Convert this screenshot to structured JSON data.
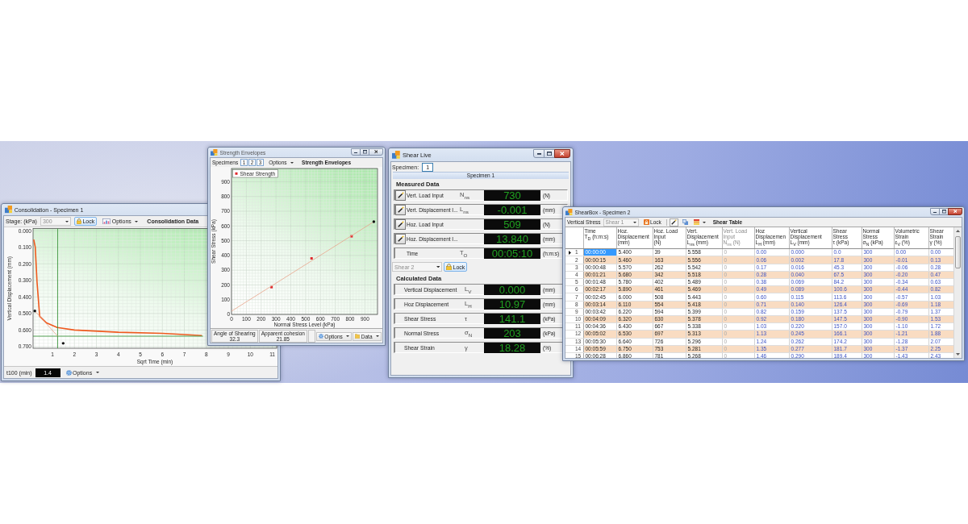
{
  "consolidation_window": {
    "title": "Consolidation - Specimen 1",
    "toolbar": {
      "stage_label": "Stage: (kPa)",
      "stage_dropdown": {
        "value": "300",
        "disabled": true
      },
      "lock_button": "Lock",
      "options_button": "Options",
      "heading": "Consolidation Data"
    },
    "chart_data": {
      "type": "line",
      "xlabel": "Sqrt Time (min)",
      "ylabel": "Vertical Displacement (mm)",
      "x": [
        0.15,
        0.22,
        0.3,
        0.42,
        0.73,
        1.22,
        2.0,
        4.0,
        6.0,
        7.8
      ],
      "values": [
        0.053,
        0.1,
        0.31,
        0.517,
        0.557,
        0.585,
        0.6,
        0.613,
        0.62,
        0.633
      ],
      "xlim": [
        0.12,
        11.2
      ],
      "ylim": [
        0.71,
        -0.013
      ],
      "xticks": [
        1,
        2,
        3,
        4,
        5,
        6,
        7,
        8,
        9,
        10,
        11
      ],
      "yticks": [
        {
          "value": 0,
          "label": "0.000"
        },
        {
          "value": 0.1,
          "label": "0.100"
        },
        {
          "value": 0.2,
          "label": "0.200"
        },
        {
          "value": 0.3,
          "label": "0.300"
        },
        {
          "value": 0.4,
          "label": "0.400"
        },
        {
          "value": 0.5,
          "label": "0.500"
        },
        {
          "value": 0.6,
          "label": "0.600"
        },
        {
          "value": 0.7,
          "label": "0.700"
        }
      ],
      "grid": true
    },
    "footer": {
      "t100_label": "t100 (min)",
      "t100_value": "1.4",
      "options_button": "Options"
    }
  },
  "strength_window": {
    "title": "Strength Envelopes",
    "active": false,
    "toolbar": {
      "specimens_label": "Specimens",
      "specimen_buttons": [
        "1",
        "2",
        "3"
      ],
      "options_button": "Options",
      "heading": "Strength Envelopes"
    },
    "chart_data": {
      "type": "scatter",
      "xlabel": "Normal Stress Level (kPa)",
      "ylabel": "Shear Stress (kPa)",
      "x": [
        270,
        540,
        810
      ],
      "series": [
        {
          "name": "Shear Strength",
          "color": "#e0282c",
          "values": [
            185,
            380,
            530
          ]
        }
      ],
      "xlim": [
        0,
        985
      ],
      "ylim": [
        0,
        990
      ],
      "xticks": [
        0,
        100,
        200,
        300,
        400,
        500,
        600,
        700,
        800,
        900
      ],
      "yticks": [
        0,
        100,
        200,
        300,
        400,
        500,
        600,
        700,
        800,
        900
      ],
      "grid": true
    },
    "results": [
      {
        "label": "Angle of Shearing",
        "value": "32.3"
      },
      {
        "label": "Apparent cohesion",
        "value": "21.85"
      }
    ],
    "options_button": "Options",
    "data_button": "Data"
  },
  "shear_live_window": {
    "title": "Shear Live",
    "active": true,
    "specimen_label": "Specimen:",
    "specimen_button": "1",
    "specimen_header": "Specimen 1",
    "measured_heading": "Measured Data",
    "measured": [
      {
        "kind": "sensor",
        "label": "Vert. Load Input",
        "symbol": "N$_{ns}$",
        "value": "730",
        "unit": "(N)"
      },
      {
        "kind": "sensor",
        "label": "Vert. Displacement I...",
        "symbol": "L$_{ns}$",
        "value": "-0.001",
        "unit": "(mm)"
      },
      {
        "kind": "sensor",
        "label": "Hoz. Load Input",
        "value": "509",
        "unit": "(N)"
      },
      {
        "kind": "sensor",
        "label": "Hoz. Displacement I...",
        "value": "13.840",
        "unit": "(mm)"
      },
      {
        "kind": "clock",
        "label": "Time",
        "symbol": "T$_{O}$",
        "value": "00:05:10",
        "unit": "(h:m:s)"
      }
    ],
    "stage_dropdown": {
      "value": "Shear 2",
      "disabled": true
    },
    "lock_button": "Lock",
    "calculated_heading": "Calculated Data",
    "calculated": [
      {
        "label": "Vertical Displacement",
        "symbol": "L$_{V}$",
        "value": "0.000",
        "unit": "(mm)"
      },
      {
        "label": "Hoz Displacement",
        "symbol": "L$_{H}$",
        "value": "10.97",
        "unit": "(mm)"
      },
      {
        "label": "Shear Stress",
        "symbol": "τ",
        "value": "141.1",
        "unit": "(kPa)"
      },
      {
        "label": "Normal Stress",
        "symbol": "σ$_{N}$",
        "value": "203",
        "unit": "(kPa)"
      },
      {
        "label": "Shear Strain",
        "symbol": "γ",
        "value": "18.28",
        "unit": "(%)"
      }
    ]
  },
  "shearbox_window": {
    "title": "ShearBox - Specimen 2",
    "active": true,
    "toolbar": {
      "stress_label": "Vertical Stress",
      "stage_dropdown": {
        "value": "Shear 1",
        "disabled": true
      },
      "lock_button": "Lock",
      "heading": "Shear Table"
    },
    "table": {
      "columns": [
        {
          "kind": "measured",
          "label": "Time",
          "sublabel": "T$_{D}$ (h:m:s)"
        },
        {
          "kind": "measured",
          "label": "Hoz. Displacement",
          "sublabel": "(mm)"
        },
        {
          "kind": "measured",
          "label": "Hoz. Load Input",
          "sublabel": "(N)"
        },
        {
          "kind": "measured",
          "label": "Vert. Displacement",
          "sublabel": "L$_{ns}$ (mm)"
        },
        {
          "kind": "inactive",
          "label": "Vert. Load Input",
          "sublabel": "N$_{ns}$ (N)"
        },
        {
          "kind": "calculated",
          "label": "Hoz Displacemen",
          "sublabel": "L$_{H}$ (mm)"
        },
        {
          "kind": "calculated",
          "label": "Vertical Displacement",
          "sublabel": "L$_{V}$ (mm)"
        },
        {
          "kind": "calculated",
          "label": "Shear Stress",
          "sublabel": "τ (kPa)"
        },
        {
          "kind": "calculated",
          "label": "Normal Stress",
          "sublabel": "σ$_{N}$ (kPa)"
        },
        {
          "kind": "calculated",
          "label": "Volumetric Strain",
          "sublabel": "ε$_{V}$ (%)"
        },
        {
          "kind": "calculated",
          "label": "Shear Strain",
          "sublabel": "γ (%)"
        }
      ],
      "rows": [
        {
          "number": "1",
          "selected": true,
          "cells": [
            "00:00:00",
            "5.400",
            "39",
            "5.558",
            "0",
            "0.00",
            "0.000",
            "0.0",
            "300",
            "0.00",
            "0.00"
          ]
        },
        {
          "number": "2",
          "selected": false,
          "cells": [
            "00:00:15",
            "5.460",
            "163",
            "5.556",
            "0",
            "0.06",
            "0.002",
            "17.8",
            "300",
            "-0.01",
            "0.13"
          ]
        },
        {
          "number": "3",
          "selected": false,
          "cells": [
            "00:00:48",
            "5.570",
            "262",
            "5.542",
            "0",
            "0.17",
            "0.016",
            "45.3",
            "300",
            "-0.06",
            "0.28"
          ]
        },
        {
          "number": "4",
          "selected": false,
          "cells": [
            "00:01:21",
            "5.680",
            "342",
            "5.518",
            "0",
            "0.28",
            "0.040",
            "67.5",
            "300",
            "-0.20",
            "0.47"
          ]
        },
        {
          "number": "5",
          "selected": false,
          "cells": [
            "00:01:48",
            "5.780",
            "402",
            "5.489",
            "0",
            "0.38",
            "0.069",
            "84.2",
            "300",
            "-0.34",
            "0.63"
          ]
        },
        {
          "number": "6",
          "selected": false,
          "cells": [
            "00:02:17",
            "5.890",
            "461",
            "5.469",
            "0",
            "0.49",
            "0.089",
            "100.6",
            "300",
            "-0.44",
            "0.82"
          ]
        },
        {
          "number": "7",
          "selected": false,
          "cells": [
            "00:02:45",
            "6.000",
            "508",
            "5.443",
            "0",
            "0.60",
            "0.115",
            "113.6",
            "300",
            "-0.57",
            "1.03"
          ]
        },
        {
          "number": "8",
          "selected": false,
          "cells": [
            "00:03:14",
            "6.110",
            "554",
            "5.418",
            "0",
            "0.71",
            "0.140",
            "126.4",
            "300",
            "-0.69",
            "1.18"
          ]
        },
        {
          "number": "9",
          "selected": false,
          "cells": [
            "00:03:42",
            "6.220",
            "594",
            "5.399",
            "0",
            "0.82",
            "0.159",
            "137.5",
            "300",
            "-0.79",
            "1.37"
          ]
        },
        {
          "number": "10",
          "selected": false,
          "cells": [
            "00:04:09",
            "6.320",
            "630",
            "5.378",
            "0",
            "0.92",
            "0.180",
            "147.5",
            "300",
            "-0.90",
            "1.53"
          ]
        },
        {
          "number": "11",
          "selected": false,
          "cells": [
            "00:04:36",
            "6.430",
            "667",
            "5.338",
            "0",
            "1.03",
            "0.220",
            "157.0",
            "300",
            "-1.10",
            "1.72"
          ]
        },
        {
          "number": "12",
          "selected": false,
          "cells": [
            "00:05:02",
            "6.530",
            "697",
            "5.313",
            "0",
            "1.13",
            "0.245",
            "166.1",
            "300",
            "-1.21",
            "1.88"
          ]
        },
        {
          "number": "13",
          "selected": false,
          "cells": [
            "00:05:30",
            "6.640",
            "726",
            "5.296",
            "0",
            "1.24",
            "0.262",
            "174.2",
            "300",
            "-1.28",
            "2.07"
          ]
        },
        {
          "number": "14",
          "selected": false,
          "cells": [
            "00:05:59",
            "6.750",
            "753",
            "5.281",
            "0",
            "1.35",
            "0.277",
            "181.7",
            "300",
            "-1.37",
            "2.25"
          ]
        },
        {
          "number": "15",
          "selected": false,
          "cells": [
            "00:06:28",
            "6.860",
            "781",
            "5.268",
            "0",
            "1.46",
            "0.290",
            "189.4",
            "300",
            "-1.43",
            "2.43"
          ]
        }
      ]
    }
  }
}
